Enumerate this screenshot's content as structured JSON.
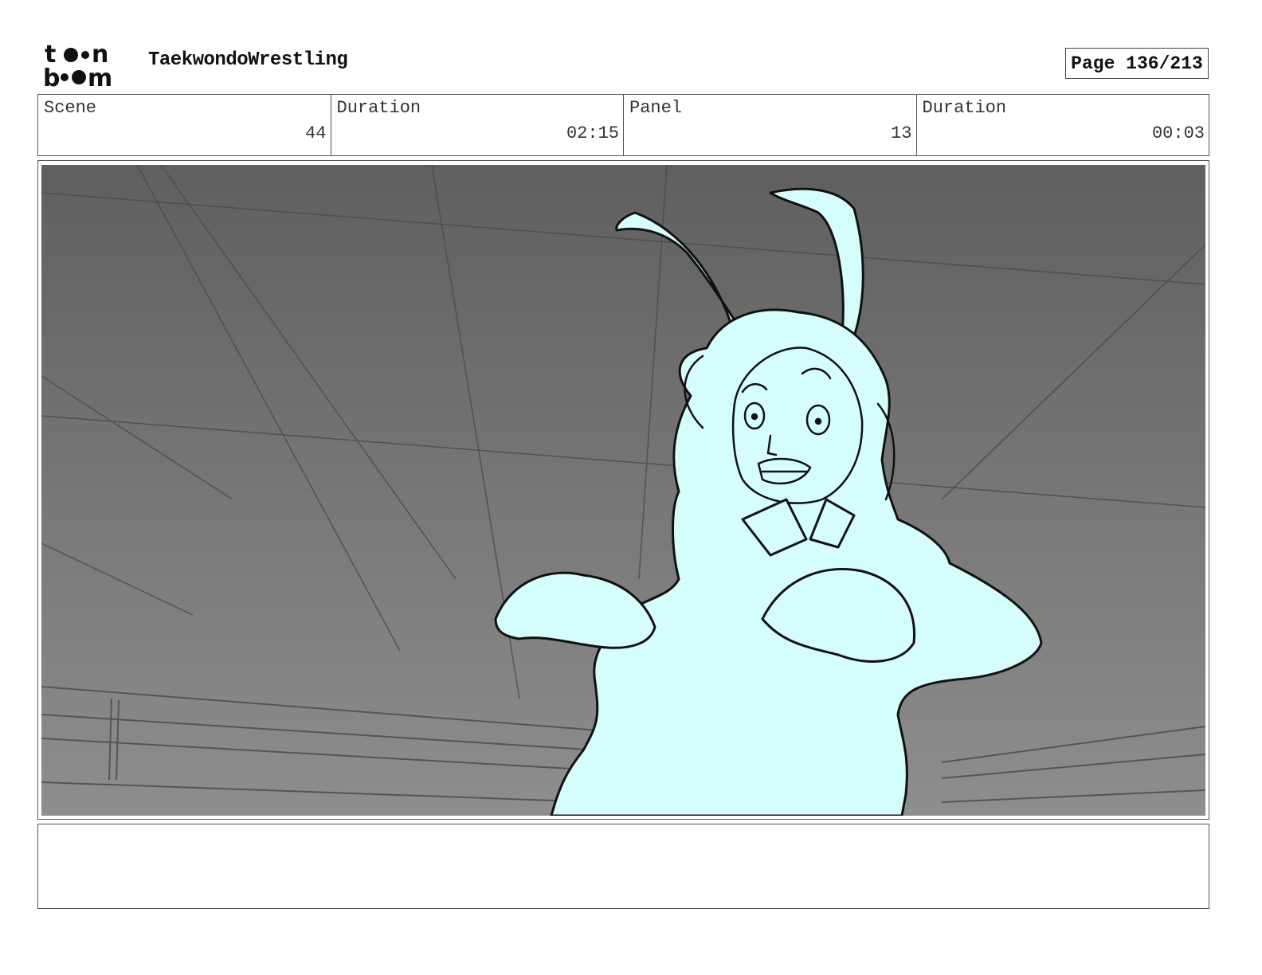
{
  "logo": {
    "line1": "to n",
    "line2": "b m"
  },
  "header": {
    "project_title": "TaekwondoWrestling",
    "page_label": "Page 136/213"
  },
  "info": [
    {
      "label": "Scene",
      "value": "44"
    },
    {
      "label": "Duration",
      "value": "02:15"
    },
    {
      "label": "Panel",
      "value": "13"
    },
    {
      "label": "Duration",
      "value": "00:03"
    }
  ],
  "panel": {
    "description": "",
    "character_fill": "#d5fdfb",
    "bg_top": "#5f5f5f",
    "bg_bottom": "#8e8e8e"
  },
  "notes": {
    "text": ""
  }
}
